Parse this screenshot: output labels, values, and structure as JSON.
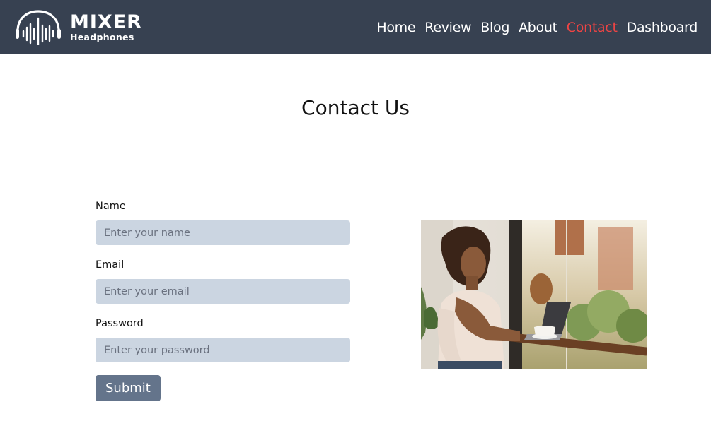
{
  "brand": {
    "title": "MIXER",
    "subtitle": "Headphones",
    "icon": "headphones-soundwave-icon"
  },
  "nav": {
    "items": [
      {
        "label": "Home",
        "active": false
      },
      {
        "label": "Review",
        "active": false
      },
      {
        "label": "Blog",
        "active": false
      },
      {
        "label": "About",
        "active": false
      },
      {
        "label": "Contact",
        "active": true
      },
      {
        "label": "Dashboard",
        "active": false
      }
    ]
  },
  "page": {
    "title": "Contact Us"
  },
  "form": {
    "name": {
      "label": "Name",
      "placeholder": "Enter your name",
      "value": ""
    },
    "email": {
      "label": "Email",
      "placeholder": "Enter your email",
      "value": ""
    },
    "password": {
      "label": "Password",
      "placeholder": "Enter your password",
      "value": ""
    },
    "submit_label": "Submit"
  },
  "colors": {
    "navbar": "#374151",
    "active_link": "#ef4444",
    "input_bg": "#cbd5e1",
    "button_bg": "#64748b"
  }
}
